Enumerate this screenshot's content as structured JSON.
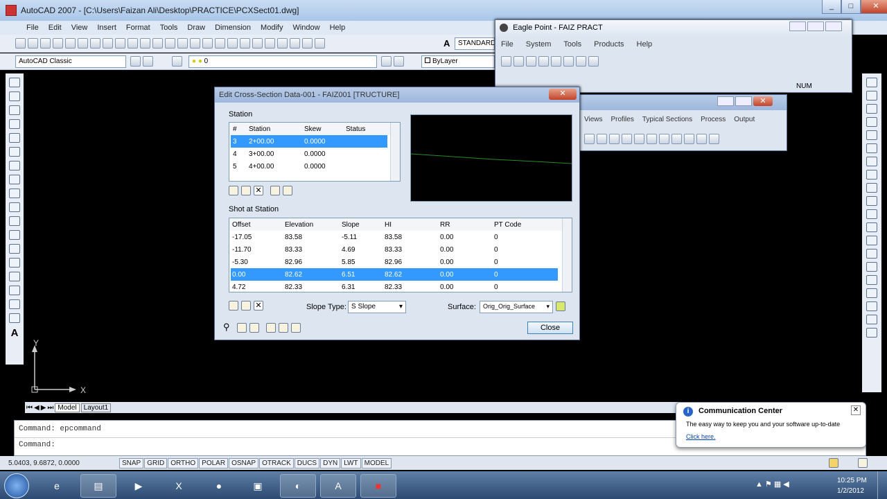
{
  "app": {
    "title": "AutoCAD 2007 - [C:\\Users\\Faizan Ali\\Desktop\\PRACTICE\\PCXSect01.dwg]",
    "win_min": "_",
    "win_max": "□",
    "win_close": "✕"
  },
  "menu": [
    "File",
    "Edit",
    "View",
    "Insert",
    "Format",
    "Tools",
    "Draw",
    "Dimension",
    "Modify",
    "Window",
    "Help"
  ],
  "toolbar": {
    "workspace": "AutoCAD Classic",
    "layer": "0",
    "style": "STANDARD",
    "color": "ByLayer"
  },
  "drawing": {
    "ucs_x": "X",
    "ucs_y": "Y",
    "tabs": [
      "Model",
      "Layout1"
    ]
  },
  "command": {
    "line1": "Command: epcommand",
    "line2": "Command:"
  },
  "status": {
    "coords": "5.0403, 9.6872, 0.0000",
    "buttons": [
      "SNAP",
      "GRID",
      "ORTHO",
      "POLAR",
      "OSNAP",
      "OTRACK",
      "DUCS",
      "DYN",
      "LWT",
      "MODEL"
    ]
  },
  "eagle": {
    "title": "Eagle Point - FAIZ PRACT",
    "menu": [
      "File",
      "System",
      "Tools",
      "Products",
      "Help"
    ],
    "status": "NUM",
    "sub_menu": [
      "Views",
      "Profiles",
      "Typical Sections",
      "Process",
      "Output"
    ]
  },
  "dialog": {
    "title": "Edit Cross-Section Data-001 - FAIZ001 [TRUCTURE]",
    "station_label": "Station",
    "station_cols": [
      "#",
      "Station",
      "Skew",
      "Status"
    ],
    "station_rows": [
      [
        "3",
        "2+00.00",
        "0.0000",
        ""
      ],
      [
        "4",
        "3+00.00",
        "0.0000",
        ""
      ],
      [
        "5",
        "4+00.00",
        "0.0000",
        ""
      ]
    ],
    "shot_label": "Shot at Station",
    "shot_cols": [
      "Offset",
      "Elevation",
      "Slope",
      "HI",
      "RR",
      "PT Code"
    ],
    "shot_rows": [
      [
        "-17.05",
        "83.58",
        "-5.11",
        "83.58",
        "0.00",
        "0"
      ],
      [
        "-11.70",
        "83.33",
        "4.69",
        "83.33",
        "0.00",
        "0"
      ],
      [
        "-5.30",
        "82.96",
        "5.85",
        "82.96",
        "0.00",
        "0"
      ],
      [
        "0.00",
        "82.62",
        "6.51",
        "82.62",
        "0.00",
        "0"
      ],
      [
        "4.72",
        "82.33",
        "6.31",
        "82.33",
        "0.00",
        "0"
      ]
    ],
    "selected_station": 0,
    "selected_shot": 3,
    "slope_type_label": "Slope Type:",
    "slope_type": "S Slope",
    "surface_label": "Surface:",
    "surface": "Orig_Orig_Surface",
    "close": "Close"
  },
  "notification": {
    "title": "Communication Center",
    "text": "The easy way to keep you and your software up-to-date",
    "link": "Click here."
  },
  "clock": {
    "time": "10:25 PM",
    "date": "1/2/2012"
  }
}
